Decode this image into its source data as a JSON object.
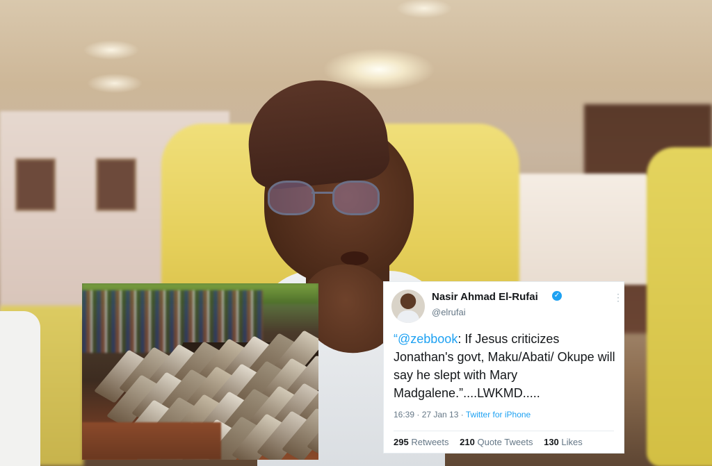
{
  "tweet": {
    "name": "Nasir Ahmad El-Rufai",
    "handle": "@elrufai",
    "mention": "“@zebbook",
    "text": ": If Jesus criticizes Jonathan's govt, Maku/Abati/ Okupe will say he slept with Mary Madgalene.”....LWKMD.....",
    "time": "16:39 · 27 Jan 13 · ",
    "source": "Twitter for iPhone",
    "retweets_count": "295",
    "retweets_label": "Retweets",
    "quotes_count": "210",
    "quotes_label": "Quote Tweets",
    "likes_count": "130",
    "likes_label": "Likes",
    "more_icon": "more-vertical-icon",
    "verified_icon": "verified-badge-icon"
  },
  "colors": {
    "accent": "#1da1f2",
    "chair": "#e5cf5a",
    "text": "#14171a",
    "muted": "#657786"
  }
}
